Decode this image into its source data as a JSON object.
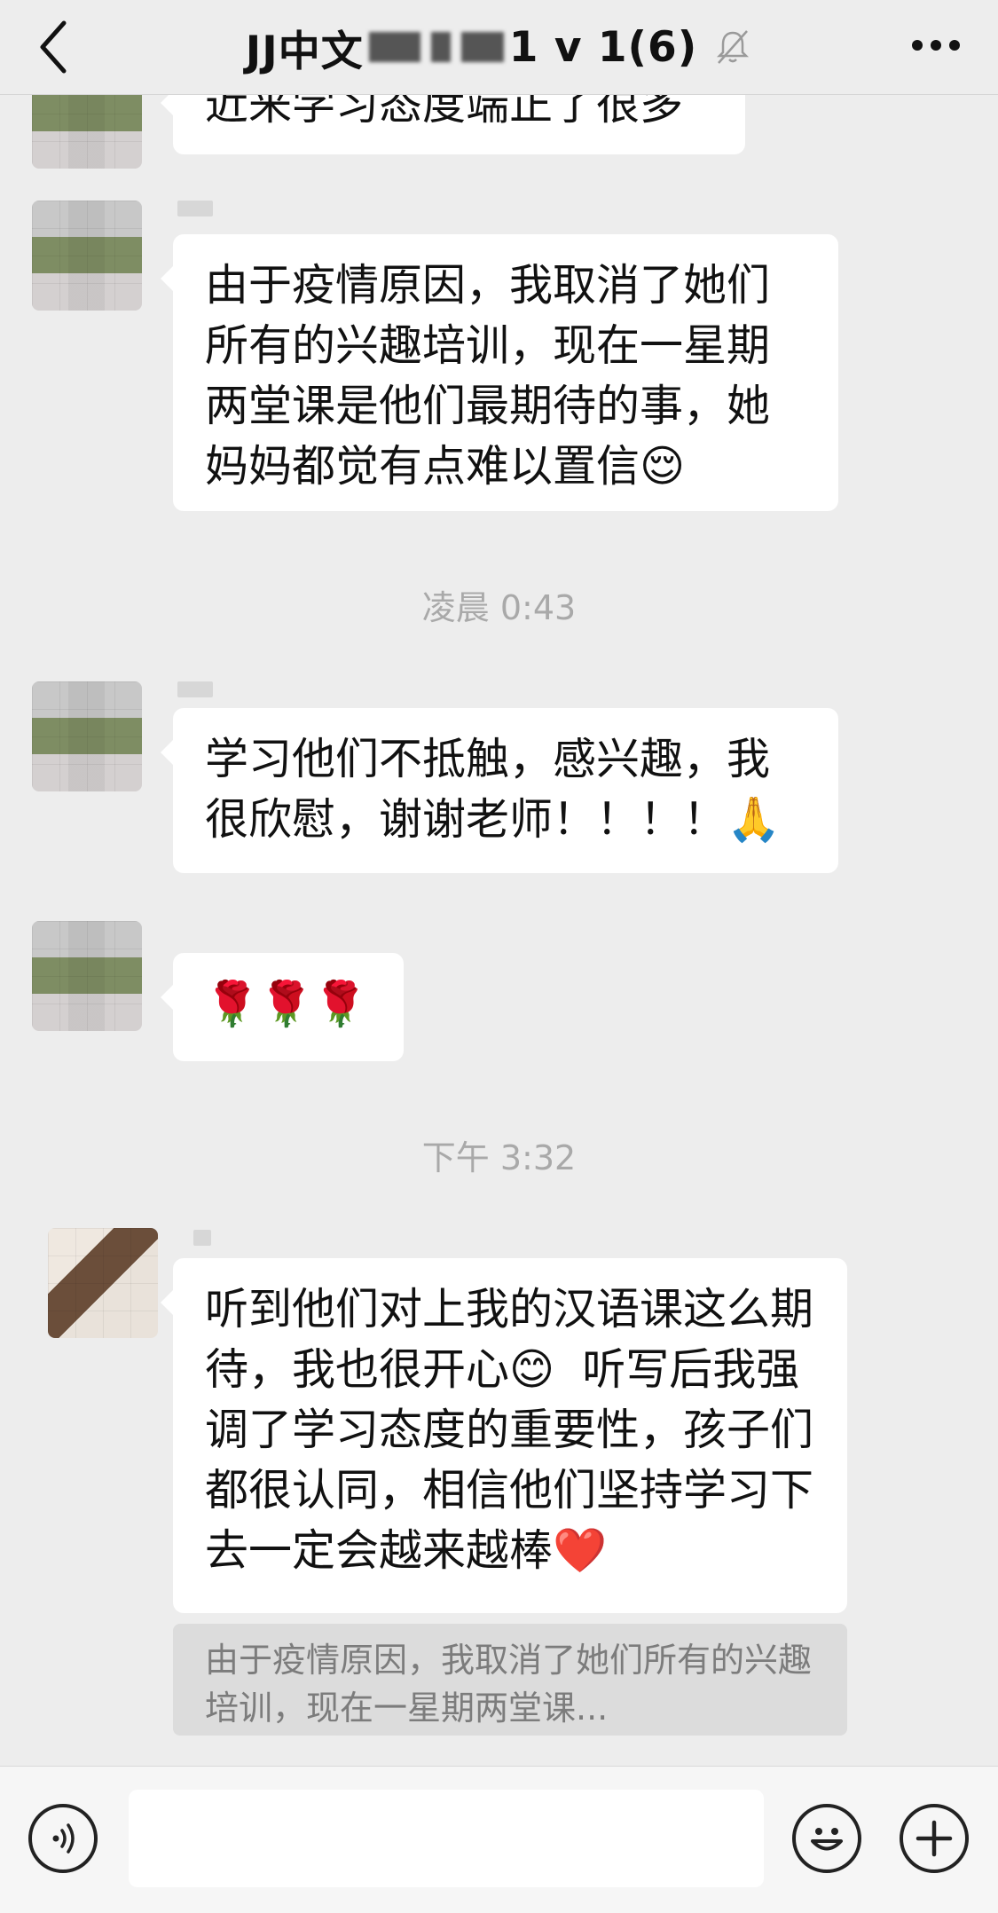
{
  "header": {
    "title_prefix": "JJ中文",
    "title_suffix": "1 v 1(6)",
    "icons": {
      "back": "chevron-left-icon",
      "muted": "bell-muted-icon",
      "more": "more-dots-icon"
    }
  },
  "messages": [
    {
      "text": "近来学习态度端正了很多"
    },
    {
      "text": "由于疫情原因，我取消了她们所有的兴趣培训，现在一星期两堂课是他们最期待的事，她妈妈都觉有点难以置信😌"
    },
    {
      "time": "凌晨 0:43"
    },
    {
      "text": "学习他们不抵触，感兴趣，我很欣慰，谢谢老师！！！！🙏"
    },
    {
      "text": "🌹🌹🌹"
    },
    {
      "time": "下午 3:32"
    },
    {
      "text": "听到他们对上我的汉语课这么期待，我也很开心😊  听写后我强调了学习态度的重要性，孩子们都很认同，相信他们坚持学习下去一定会越来越棒❤️",
      "quote": "由于疫情原因，我取消了她们所有的兴趣培训，现在一星期两堂课..."
    }
  ],
  "input_bar": {
    "icons": {
      "voice": "voice-icon",
      "emoji": "emoji-icon",
      "plus": "plus-icon"
    }
  },
  "colors": {
    "background": "#ededed",
    "bubble": "#ffffff",
    "timestamp": "#a9a9a9"
  }
}
